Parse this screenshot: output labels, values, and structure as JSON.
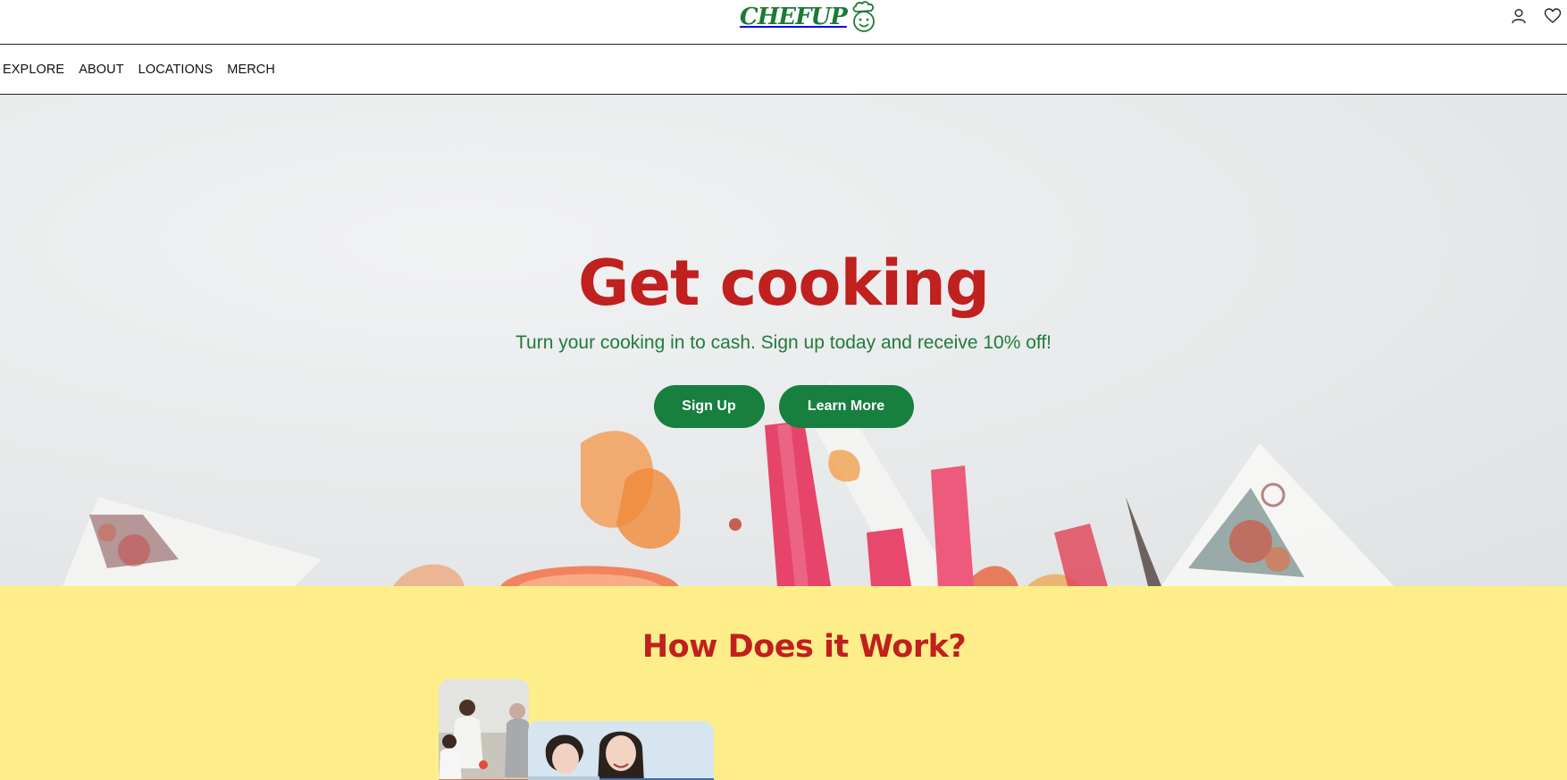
{
  "header": {
    "brand": "CHEFUP",
    "icons": [
      "user-icon",
      "heart-icon"
    ]
  },
  "nav": {
    "items": [
      {
        "label": "EXPLORE"
      },
      {
        "label": "ABOUT"
      },
      {
        "label": "LOCATIONS"
      },
      {
        "label": "MERCH"
      }
    ]
  },
  "hero": {
    "title": "Get cooking",
    "subtitle": "Turn your cooking in to cash. Sign up today and receive 10% off!",
    "signup_label": "Sign Up",
    "learn_more_label": "Learn More"
  },
  "how": {
    "title": "How Does it Work?"
  },
  "colors": {
    "brand_green": "#17803f",
    "accent_red": "#c0201e",
    "section_yellow": "#fdee8a"
  }
}
